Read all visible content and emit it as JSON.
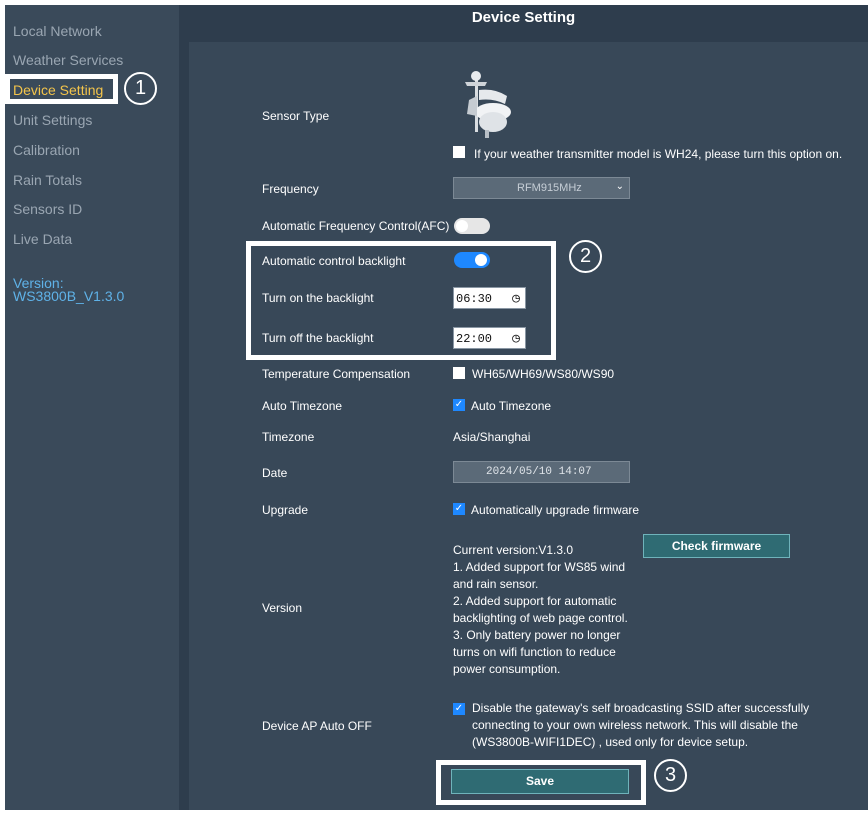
{
  "sidebar": {
    "items": [
      {
        "label": "Local Network"
      },
      {
        "label": "Weather Services"
      },
      {
        "label": "Device Setting"
      },
      {
        "label": "Unit Settings"
      },
      {
        "label": "Calibration"
      },
      {
        "label": "Rain Totals"
      },
      {
        "label": "Sensors ID"
      },
      {
        "label": "Live Data"
      }
    ],
    "version_label": "Version:",
    "version_value": "WS3800B_V1.3.0"
  },
  "badges": {
    "one": "1",
    "two": "2",
    "three": "3"
  },
  "header": {
    "title": "Device Setting"
  },
  "form": {
    "sensor_type": {
      "label": "Sensor Type",
      "wh24_text": "If your weather transmitter model is WH24, please turn this option on.",
      "wh24_checked": false
    },
    "frequency": {
      "label": "Frequency",
      "value": "RFM915MHz"
    },
    "afc": {
      "label": "Automatic Frequency Control(AFC)",
      "enabled": false
    },
    "auto_backlight": {
      "label": "Automatic control backlight",
      "enabled": true
    },
    "backlight_on": {
      "label": "Turn on the backlight",
      "value": "06:30"
    },
    "backlight_off": {
      "label": "Turn off the backlight",
      "value": "22:00"
    },
    "temp_comp": {
      "label": "Temperature Compensation",
      "option": "WH65/WH69/WS80/WS90",
      "checked": false
    },
    "auto_timezone": {
      "label": "Auto Timezone",
      "option": "Auto Timezone",
      "checked": true
    },
    "timezone": {
      "label": "Timezone",
      "value": "Asia/Shanghai"
    },
    "date": {
      "label": "Date",
      "value": "2024/05/10 14:07"
    },
    "upgrade": {
      "label": "Upgrade",
      "option": "Automatically upgrade firmware",
      "checked": true
    },
    "version": {
      "label": "Version",
      "lines": [
        "Current version:V1.3.0",
        "1. Added support for WS85 wind",
        "and rain sensor.",
        "2. Added support for automatic",
        "backlighting of web page control.",
        "3. Only battery power no longer",
        "turns on wifi function to reduce",
        "power consumption."
      ],
      "check_button": "Check firmware"
    },
    "ap_auto_off": {
      "label": "Device AP Auto OFF",
      "lines": [
        "Disable the gateway's self broadcasting SSID after successfully",
        "connecting to your own wireless network. This will disable the",
        "(WS3800B-WIFI1DEC) , used only for device setup."
      ],
      "checked": true
    },
    "save_button": "Save"
  },
  "colors": {
    "sidebar_bg": "#3a4a5a",
    "main_bg": "#2e3d4d",
    "panel_bg": "#384858",
    "active_nav": "#f3c44b",
    "version_link": "#5fb2e8",
    "toggle_on": "#1e88ff",
    "button_bg": "#2f6b73"
  },
  "icons": {
    "sensor": "weather-sensor-icon",
    "clock": "clock-icon",
    "chevron": "chevron-down-icon",
    "check": "check-icon"
  }
}
